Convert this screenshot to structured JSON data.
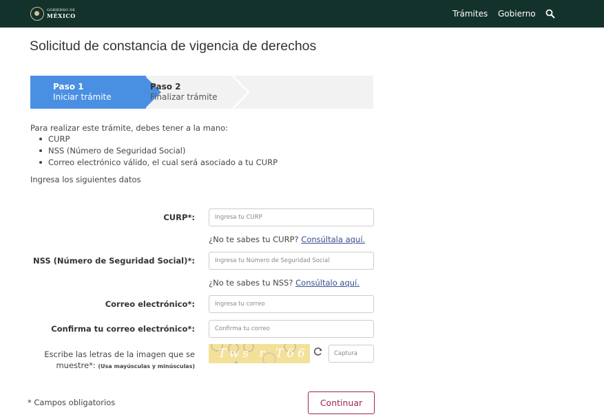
{
  "header": {
    "logo_line1": "GOBIERNO DE",
    "logo_line2": "MÉXICO",
    "nav": [
      {
        "label": "Trámites"
      },
      {
        "label": "Gobierno"
      }
    ],
    "search_icon": "search-icon"
  },
  "page": {
    "title": "Solicitud de constancia de vigencia de derechos"
  },
  "stepper": {
    "steps": [
      {
        "title": "Paso 1",
        "subtitle": "Iniciar trámite",
        "active": true
      },
      {
        "title": "Paso 2",
        "subtitle": "Finalizar trámite",
        "active": false
      }
    ],
    "active_color": "#4a90e2"
  },
  "intro": {
    "text": "Para realizar este trámite, debes tener a la mano:",
    "requirements": [
      "CURP",
      "NSS (Número de Seguridad Social)",
      "Correo electrónico válido, el cual será asociado a tu CURP"
    ],
    "instruction": "Ingresa los siguientes datos"
  },
  "form": {
    "curp": {
      "label": "CURP*:",
      "placeholder": "Ingresa tu CURP",
      "value": "",
      "help_text": "¿No te sabes tu CURP?",
      "help_link": "Consúltala aquí."
    },
    "nss": {
      "label": "NSS (Número de Seguridad Social)*:",
      "placeholder": "Ingresa tu Número de Seguridad Social",
      "value": "",
      "help_text": "¿No te sabes tu NSS?",
      "help_link": "Consúltalo aquí."
    },
    "email": {
      "label": "Correo electrónico*:",
      "placeholder": "Ingresa tu correo",
      "value": ""
    },
    "email_confirm": {
      "label": "Confirma tu correo electrónico*:",
      "placeholder": "Confirma tu correo",
      "value": ""
    },
    "captcha": {
      "label": "Escribe las letras de la imagen que se muestre*:",
      "label_note": "(Usa mayúsculas y minúsculas)",
      "image_text": "Tws r T66",
      "placeholder": "Captura",
      "value": "",
      "refresh_icon": "refresh-icon"
    },
    "required_note": "* Campos obligatorios",
    "submit_label": "Continuar"
  },
  "colors": {
    "header_bg": "#13322b",
    "accent": "#9d2449",
    "link": "#3a4b8e"
  }
}
